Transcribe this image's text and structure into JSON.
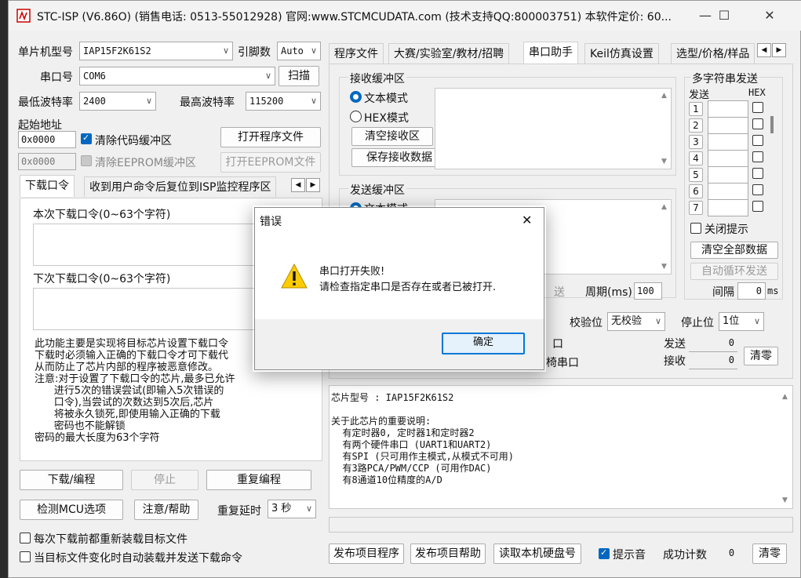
{
  "window": {
    "title": "STC-ISP (V6.86O) (销售电话: 0513-55012928) 官网:www.STCMCUDATA.com  (技术支持QQ:800003751) 本软件定价: 60...",
    "minimize": "—",
    "maximize": "☐",
    "close": "✕"
  },
  "left": {
    "mcu_label": "单片机型号",
    "mcu_value": "IAP15F2K61S2",
    "pins_label": "引脚数",
    "pins_value": "Auto",
    "port_label": "串口号",
    "port_value": "COM6",
    "scan_button": "扫描",
    "min_baud_label": "最低波特率",
    "min_baud_value": "2400",
    "max_baud_label": "最高波特率",
    "max_baud_value": "115200",
    "start_addr_label": "起始地址",
    "addr1": "0x0000",
    "addr2": "0x0000",
    "clear_code_label": "清除代码缓冲区",
    "clear_eeprom_label": "清除EEPROM缓冲区",
    "open_program_button": "打开程序文件",
    "open_eeprom_button": "打开EEPROM文件",
    "tab1": "下载口令",
    "tab2": "收到用户命令后复位到ISP监控程序区",
    "current_pwd_label": "本次下载口令(0~63个字符)",
    "next_pwd_label": "下次下载口令(0~63个字符)",
    "notes": "此功能主要是实现将目标芯片设置下载口令\n下载时必须输入正确的下载口令才可下载代\n从而防止了芯片内部的程序被恶意修改。\n注意:对于设置了下载口令的芯片,最多已允许\n      进行5次的错误尝试(即输入5次错误的\n      口令),当尝试的次数达到5次后,芯片\n      将被永久锁死,即使用输入正确的下载\n      密码也不能解锁\n密码的最大长度为63个字符",
    "download_button": "下载/编程",
    "stop_button": "停止",
    "reprogram_button": "重复编程",
    "detect_button": "检测MCU选项",
    "help_button": "注意/帮助",
    "repeat_delay_label": "重复延时",
    "repeat_delay_value": "3 秒",
    "reload_label": "每次下载前都重新装载目标文件",
    "auto_reload_label": "当目标文件变化时自动装载并发送下载命令"
  },
  "right": {
    "tabs": [
      "程序文件",
      "大赛/实验室/教材/招聘",
      "串口助手",
      "Keil仿真设置",
      "选型/价格/样品"
    ],
    "recv_title": "接收缓冲区",
    "recv_text_mode": "文本模式",
    "recv_hex_mode": "HEX模式",
    "clear_recv_button": "清空接收区",
    "save_recv_button": "保存接收数据",
    "send_title": "发送缓冲区",
    "send_text_mode": "文本模式",
    "send_button_partial": "送",
    "period_label": "周期(ms)",
    "period_value": "100",
    "multi_title": "多字符串发送",
    "multi_send_header": "发送",
    "multi_hex_header": "HEX",
    "multi_rows": [
      "1",
      "2",
      "3",
      "4",
      "5",
      "6",
      "7"
    ],
    "close_hint_label": "关闭提示",
    "clear_all_button": "清空全部数据",
    "auto_loop_button": "自动循环发送",
    "interval_label": "间隔",
    "interval_value": "0",
    "interval_unit": "ms",
    "parity_label": "校验位",
    "parity_value": "无校验",
    "stop_bits_label": "停止位",
    "stop_bits_value": "1位",
    "partial_row1": "口",
    "partial_row2": "椅串口",
    "send_count_label": "发送",
    "send_count_value": "0",
    "recv_count_label": "接收",
    "recv_count_value": "0",
    "clear_counts_button": "清零",
    "chip_info": "芯片型号 : IAP15F2K61S2\n\n关于此芯片的重要说明:\n  有定时器0, 定时器1和定时器2\n  有两个硬件串口 (UART1和UART2)\n  有SPI (只可用作主模式,从模式不可用)\n  有3路PCA/PWM/CCP (可用作DAC)\n  有8通道10位精度的A/D",
    "publish_program_button": "发布项目程序",
    "publish_help_button": "发布项目帮助",
    "read_disk_button": "读取本机硬盘号",
    "beep_label": "提示音",
    "success_label": "成功计数",
    "success_value": "0",
    "clear_success_button": "清零"
  },
  "dialog": {
    "title": "错误",
    "close": "✕",
    "line1": "串口打开失败!",
    "line2": "请检查指定串口是否存在或者已被打开.",
    "ok_button": "确定",
    "warning_icon": "warning-icon"
  }
}
